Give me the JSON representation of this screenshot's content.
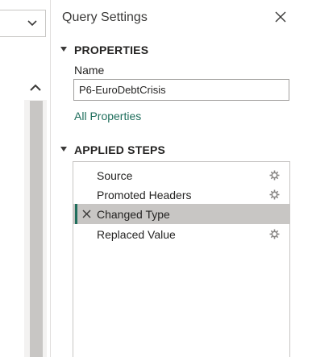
{
  "panel": {
    "title": "Query Settings",
    "close_icon": "close-icon"
  },
  "properties": {
    "heading": "PROPERTIES",
    "name_label": "Name",
    "name_value": "P6-EuroDebtCrisis",
    "all_properties_link": "All Properties"
  },
  "applied_steps": {
    "heading": "APPLIED STEPS",
    "steps": [
      {
        "label": "Source",
        "has_gear": true,
        "selected": false
      },
      {
        "label": "Promoted Headers",
        "has_gear": true,
        "selected": false
      },
      {
        "label": "Changed Type",
        "has_gear": false,
        "selected": true
      },
      {
        "label": "Replaced Value",
        "has_gear": true,
        "selected": false
      }
    ]
  },
  "colors": {
    "accent": "#1f6e5c",
    "selected_row": "#c8c6c4",
    "border": "#c8c6c4"
  },
  "icons": {
    "dropdown": "chevron-down-icon",
    "scroll_up": "chevron-up-icon",
    "step_settings": "gear-icon",
    "step_delete": "delete-x-icon"
  }
}
